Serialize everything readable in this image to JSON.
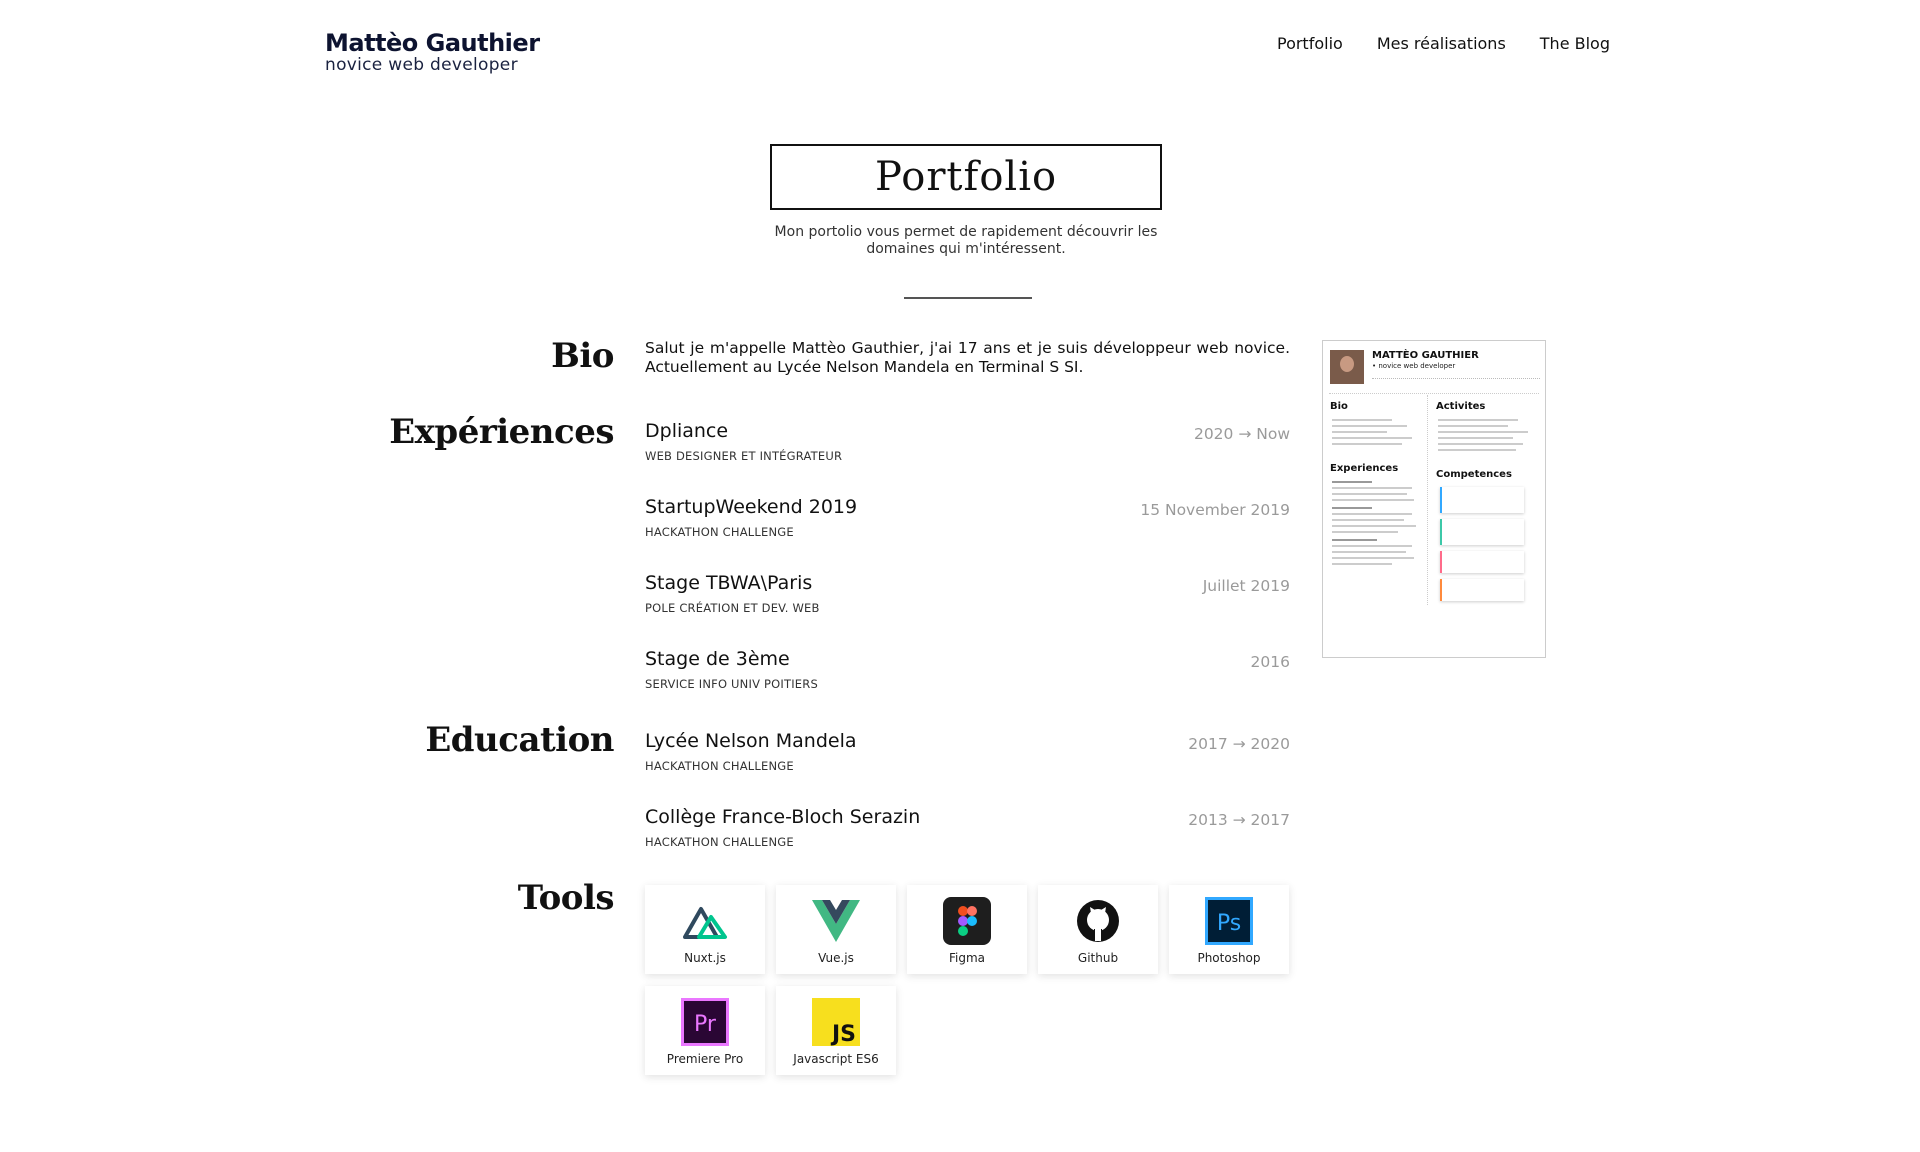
{
  "header": {
    "brand_name": "Mattèo Gauthier",
    "brand_tagline": "novice web developer",
    "nav": [
      "Portfolio",
      "Mes réalisations",
      "The Blog"
    ]
  },
  "hero": {
    "title": "Portfolio",
    "subtitle": "Mon portolio vous permet de rapidement découvrir les domaines qui m'intéressent."
  },
  "sections": {
    "bio": "Bio",
    "experiences": "Expériences",
    "education": "Education",
    "tools": "Tools"
  },
  "bio": {
    "text": "Salut je m'appelle Mattèo Gauthier, j'ai 17 ans et je suis développeur web novice. Actuellement au Lycée Nelson Mandela en Terminal S SI."
  },
  "experiences": [
    {
      "title": "Dpliance",
      "subtitle": "WEB DESIGNER ET INTÉGRATEUR",
      "date": "2020 → Now"
    },
    {
      "title": "StartupWeekend 2019",
      "subtitle": "HACKATHON CHALLENGE",
      "date": "15 November 2019"
    },
    {
      "title": "Stage TBWA\\Paris",
      "subtitle": "POLE CRÉATION ET DEV. WEB",
      "date": "Juillet 2019"
    },
    {
      "title": "Stage de 3ème",
      "subtitle": "SERVICE INFO UNIV POITIERS",
      "date": "2016"
    }
  ],
  "education": [
    {
      "title": "Lycée Nelson Mandela",
      "subtitle": "HACKATHON CHALLENGE",
      "date": "2017 → 2020"
    },
    {
      "title": "Collège France-Bloch Serazin",
      "subtitle": "HACKATHON CHALLENGE",
      "date": "2013 → 2017"
    }
  ],
  "tools": [
    {
      "label": "Nuxt.js",
      "icon": "nuxt-icon"
    },
    {
      "label": "Vue.js",
      "icon": "vue-icon"
    },
    {
      "label": "Figma",
      "icon": "figma-icon"
    },
    {
      "label": "Github",
      "icon": "github-icon"
    },
    {
      "label": "Photoshop",
      "icon": "photoshop-icon"
    },
    {
      "label": "Premiere Pro",
      "icon": "premiere-icon"
    },
    {
      "label": "Javascript ES6",
      "icon": "javascript-icon"
    }
  ],
  "cv_preview": {
    "name": "MATTÈO GAUTHIER",
    "tagline": "• novice web developer",
    "headings": [
      "Bio",
      "Activites",
      "Experiences",
      "Competences"
    ]
  },
  "colors": {
    "brand": "#0d1330",
    "date_gray": "#9a9a9a",
    "nuxt_green": "#00c58e",
    "vue_green": "#41b883",
    "vue_dark": "#35495e",
    "ps_blue": "#31a8ff",
    "pr_purple": "#ea77ff",
    "js_yellow": "#f7df1e"
  }
}
